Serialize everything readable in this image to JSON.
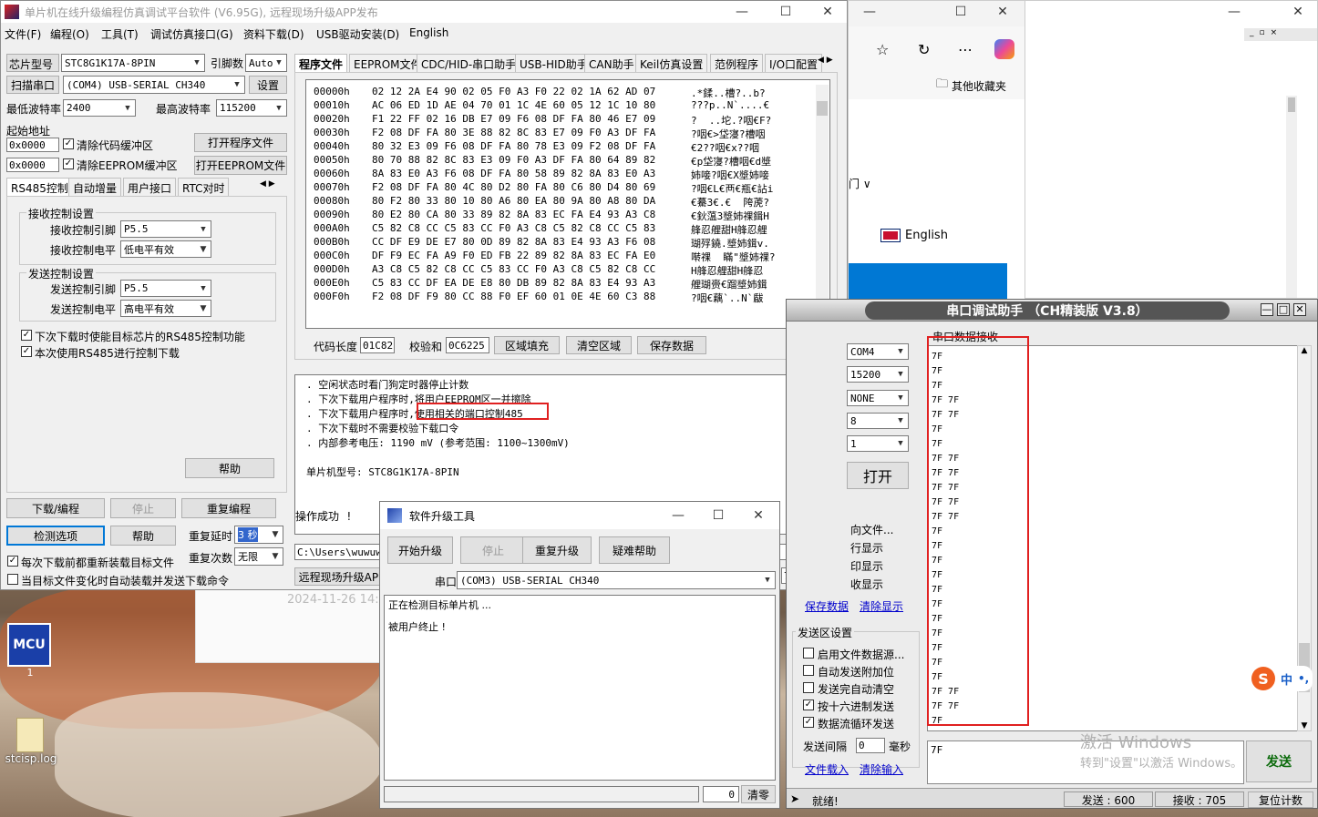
{
  "stc": {
    "title": "单片机在线升级编程仿真调试平台软件 (V6.95G), 远程现场升级APP发布",
    "menu": [
      "文件(F)",
      "编程(O)",
      "工具(T)",
      "调试仿真接口(G)",
      "资料下载(D)",
      "USB驱动安装(D)",
      "English"
    ],
    "chip_label": "芯片型号",
    "chip_value": "STC8G1K17A-8PIN",
    "pins_label": "引脚数",
    "pins_value": "Auto",
    "scan_btn": "扫描串口",
    "port_value": "(COM4) USB-SERIAL CH340",
    "settings_btn": "设置",
    "min_baud_label": "最低波特率",
    "min_baud": "2400",
    "max_baud_label": "最高波特率",
    "max_baud": "115200",
    "start_addr_label": "起始地址",
    "addr1": "0x0000",
    "clear_code": "清除代码缓冲区",
    "open_prog": "打开程序文件",
    "addr2": "0x0000",
    "clear_eeprom": "清除EEPROM缓冲区",
    "open_eeprom": "打开EEPROM文件",
    "left_tabs": [
      "RS485控制",
      "自动增量",
      "用户接口",
      "RTC对时"
    ],
    "rx_group": "接收控制设置",
    "rx_pin_label": "接收控制引脚",
    "rx_pin": "P5.5",
    "rx_level_label": "接收控制电平",
    "rx_level": "低电平有效",
    "tx_group": "发送控制设置",
    "tx_pin_label": "发送控制引脚",
    "tx_pin": "P5.5",
    "tx_level_label": "发送控制电平",
    "tx_level": "高电平有效",
    "chk_485_enable": "下次下载时使能目标芯片的RS485控制功能",
    "chk_485_use": "本次使用RS485进行控制下载",
    "help_btn": "帮助",
    "download_btn": "下载/编程",
    "stop_btn": "停止",
    "reprogram_btn": "重复编程",
    "detect_btn": "检测选项",
    "help2_btn": "帮助",
    "repeat_delay_label": "重复延时",
    "repeat_delay": "3 秒",
    "repeat_count_label": "重复次数",
    "repeat_count": "无限",
    "chk_reload": "每次下载前都重新装载目标文件",
    "chk_auto": "当目标文件变化时自动装载并发送下载命令",
    "right_tabs": [
      "程序文件",
      "EEPROM文件",
      "CDC/HID-串口助手",
      "USB-HID助手",
      "CAN助手",
      "Keil仿真设置",
      "范例程序",
      "I/O口配置"
    ],
    "hex_rows": [
      [
        "00000h",
        "02 12 2A E4 90 02 05 F0 A3 F0 22 02 1A 62 AD 07",
        ".*鍒..槽?..b?"
      ],
      [
        "00010h",
        "AC 06 ED 1D AE 04 70 01 1C 4E 60 05 12 1C 10 80",
        "???p..N`....€"
      ],
      [
        "00020h",
        "F1 22 FF 02 16 DB E7 09 F6 08 DF FA 80 46 E7 09",
        "?  ..坨.?咽€F?"
      ],
      [
        "00030h",
        "F2 08 DF FA 80 3E 88 82 8C 83 E7 09 F0 A3 DF FA",
        "?咽€>垈寖?槽咽"
      ],
      [
        "00040h",
        "80 32 E3 09 F6 08 DF FA 80 78 E3 09 F2 08 DF FA",
        "€2??咽€x??咽"
      ],
      [
        "00050h",
        "80 70 88 82 8C 83 E3 09 F0 A3 DF FA 80 64 89 82",
        "€p垈寖?槽咽€d墏"
      ],
      [
        "00060h",
        "8A 83 E0 A3 F6 08 DF FA 80 58 89 82 8A 83 E0 A3",
        "姉唼?咽€X墏姉唼"
      ],
      [
        "00070h",
        "F2 08 DF FA 80 4C 80 D2 80 FA 80 C6 80 D4 80 69",
        "?咽€L€襾€瓶€詀i"
      ],
      [
        "00080h",
        "80 F2 80 33 80 10 80 A6 80 EA 80 9A 80 A8 80 DA",
        "€驀3€.€  陓萀?"
      ],
      [
        "00090h",
        "80 E2 80 CA 80 33 89 82 8A 83 EC FA E4 93 A3 C8",
        "€鈥蕰3墏姉祼鍓H"
      ],
      [
        "000A0h",
        "C5 82 C8 CC C5 83 CC F0 A3 C8 C5 82 C8 CC C5 83",
        "艂忍艃甜H艂忍艃"
      ],
      [
        "000B0h",
        "CC DF E9 DE E7 80 0D 89 82 8A 83 E4 93 A3 F6 08",
        "瑚殍鐃.墏姉鍓v."
      ],
      [
        "000C0h",
        "DF F9 EC FA A9 F0 ED FB 22 89 82 8A 83 EC FA E0",
        "啭祼  瞞\"墏姉祼?"
      ],
      [
        "000D0h",
        "A3 C8 C5 82 C8 CC C5 83 CC F0 A3 C8 C5 82 C8 CC",
        "H艂忍艃甜H艂忍"
      ],
      [
        "000E0h",
        "C5 83 CC DF EA DE E8 80 DB 89 82 8A 83 E4 93 A3",
        "艃瑚赍€蹓墏姉鍓"
      ],
      [
        "000F0h",
        "F2 08 DF F9 80 CC 88 F0 EF 60 01 0E 4E 60 C3 88",
        "?咽€藕`..N`瞂"
      ]
    ],
    "code_len_label": "代码长度",
    "code_len": "01C82",
    "checksum_label": "校验和",
    "checksum": "0C6225",
    "fill_btn": "区域填充",
    "clear_btn": "清空区域",
    "save_btn": "保存数据",
    "log": [
      ". 空闲状态时看门狗定时器停止计数",
      ". 下次下载用户程序时,将用户EEPROM区一并擦除",
      ". 下次下载用户程序时,使用相关的端口控制485",
      ". 下次下载时不需要校验下载口令",
      ". 内部参考电压: 1190 mV (参考范围: 1100~1300mV)",
      "",
      "单片机型号: STC8G1K17A-8PIN",
      "",
      "操作成功 !"
    ],
    "log_highlight": "使用相关的端口控制485",
    "path": "C:\\Users\\wuwuwu",
    "remote_btn": "远程现场升级APP",
    "count_value": "7",
    "clear_count_btn": "清零",
    "bg_date": "2024-11-26 14:"
  },
  "browser": {
    "other_favorites": "其他收藏夹",
    "english": "English",
    "lang_frag": "门 ∨"
  },
  "upgrade": {
    "title": "软件升级工具",
    "start_btn": "开始升级",
    "stop_btn": "停止",
    "repeat_btn": "重复升级",
    "help_btn": "疑难帮助",
    "port_label": "串口",
    "port_value": "(COM3) USB-SERIAL CH340",
    "log1": "正在检测目标单片机 ...",
    "log2": "被用户终止 !",
    "count": "0",
    "clear_btn": "清零"
  },
  "serial": {
    "title": "串口调试助手 （CH精装版 V3.8）",
    "com": "COM4",
    "baud": "15200",
    "parity": "NONE",
    "data_bits": "8",
    "stop_bits": "1",
    "open_btn": "打开",
    "recv_group": "串口数据接收",
    "left_opts": [
      "向文件...",
      "行显示",
      "印显示",
      "收显示"
    ],
    "save_data": "保存数据",
    "clear_display": "清除显示",
    "send_group": "发送区设置",
    "send_opts": [
      "启用文件数据源...",
      "自动发送附加位",
      "发送完自动清空",
      "按十六进制发送",
      "数据流循环发送"
    ],
    "send_checked": [
      false,
      false,
      false,
      true,
      true
    ],
    "interval_label": "发送间隔",
    "interval": "0",
    "ms": "毫秒",
    "file_load": "文件载入",
    "clear_input": "清除输入",
    "recv_lines": [
      "7F",
      "7F",
      "7F",
      "7F  7F",
      "7F  7F",
      "7F",
      "7F",
      "7F  7F",
      "7F  7F",
      "7F  7F",
      "7F  7F",
      "7F  7F",
      "7F",
      "7F",
      "7F",
      "7F",
      "7F",
      "7F",
      "7F",
      "7F",
      "7F",
      "7F",
      "7F",
      "7F  7F",
      "7F  7F",
      "7F"
    ],
    "send_text": "7F",
    "send_btn": "发送",
    "status": "就绪!",
    "sent": "发送 : 600",
    "received": "接收 : 705",
    "reset_btn": "复位计数",
    "watermark1": "激活 Windows",
    "watermark2": "转到\"设置\"以激活 Windows。",
    "ime": "中"
  },
  "desktop": {
    "icon1": "1",
    "icon2": "stcisp.log"
  }
}
